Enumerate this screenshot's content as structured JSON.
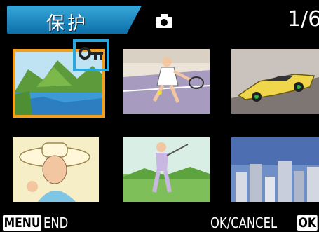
{
  "header": {
    "title": "保护",
    "mode_icon": "camera-icon",
    "counter": "1/6"
  },
  "thumbnails": [
    {
      "subject": "lake-and-mountains",
      "selected": true,
      "protected": true
    },
    {
      "subject": "tennis-player",
      "selected": false,
      "protected": false
    },
    {
      "subject": "sports-car",
      "selected": false,
      "protected": false
    },
    {
      "subject": "woman-with-hat",
      "selected": false,
      "protected": false
    },
    {
      "subject": "golfer",
      "selected": false,
      "protected": false
    },
    {
      "subject": "city-skyline",
      "selected": false,
      "protected": false
    }
  ],
  "protect_indicator": "key-icon",
  "footer": {
    "menu_key": "MENU",
    "menu_action": "END",
    "ok_action": "OK/CANCEL",
    "ok_key": "OK"
  },
  "colors": {
    "title_bar": "#1a8cc8",
    "selection_frame": "#f5a01a",
    "protect_box": "#29a8e0"
  }
}
